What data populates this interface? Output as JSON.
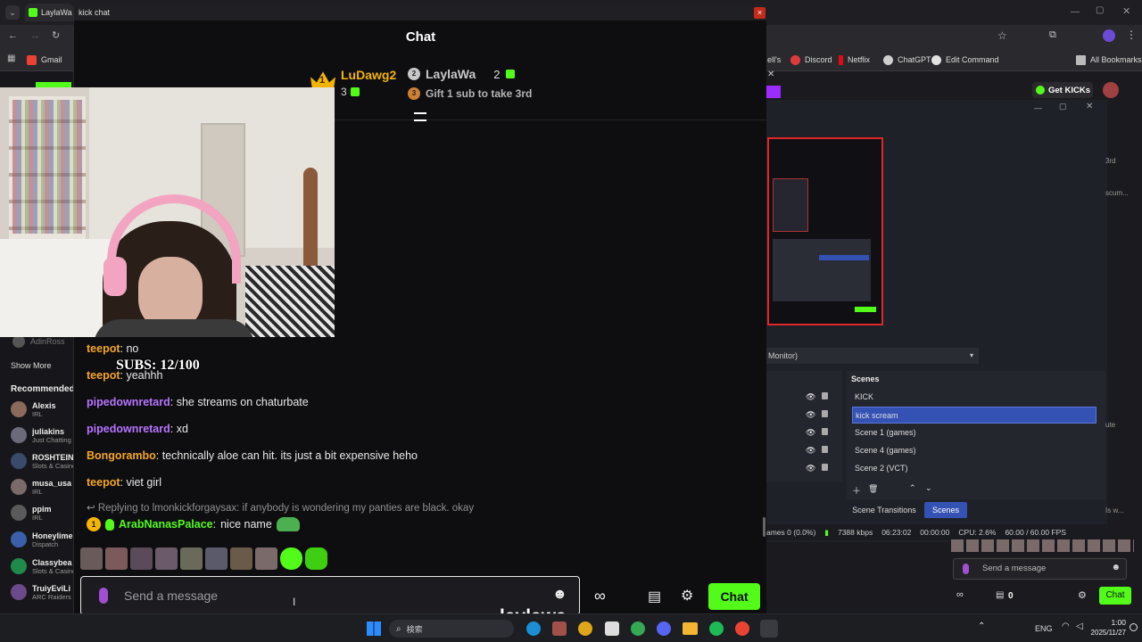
{
  "browser": {
    "tab_title": "LaylaWa",
    "bookmarks": [
      "Gmail",
      "ell's",
      "Discord",
      "Netflix",
      "ChatGPT",
      "Edit Command",
      "All Bookmarks"
    ]
  },
  "chat_window": {
    "title": "kick chat",
    "header": "Chat",
    "close_label": "×"
  },
  "leaderboard": {
    "first": {
      "rank": "1",
      "name": "LuDawg2",
      "count": "3"
    },
    "second": {
      "rank": "2",
      "name": "LaylaWa",
      "count": "2"
    },
    "third": {
      "rank": "3",
      "label": "Gift 1 sub to take 3rd"
    }
  },
  "overlay": {
    "subs": "SUBS: 12/100",
    "watermark": "laylawa"
  },
  "messages": [
    {
      "user": "teepot",
      "color": "#f5a623",
      "text": "no"
    },
    {
      "user": "teepot",
      "color": "#f5a623",
      "text": "yeahhh"
    },
    {
      "user": "pipedownretard",
      "color": "#b774ff",
      "text": "she streams on chaturbate"
    },
    {
      "user": "pipedownretard",
      "color": "#b774ff",
      "text": "xd"
    },
    {
      "user": "Bongorambo",
      "color": "#f5a623",
      "text": "technically aloe can hit. its just a bit expensive heho"
    },
    {
      "user": "teepot",
      "color": "#f5a623",
      "text": "viet girl"
    }
  ],
  "reply": {
    "text": "Replying to lmonkickforgaysax: if anybody is wondering my panties are black. okay",
    "badge": "1",
    "user": "ArabNanasPalace",
    "user_color": "#53fc18",
    "message": "nice name"
  },
  "input": {
    "placeholder": "Send a message",
    "send_label": "Chat"
  },
  "sidebar": {
    "show_more": "Show More",
    "recommended": "Recommended",
    "top_name": "AdinRoss",
    "items": [
      {
        "name": "Alexis",
        "category": "IRL"
      },
      {
        "name": "juliakins",
        "category": "Just Chatting"
      },
      {
        "name": "ROSHTEIN",
        "category": "Slots & Casino"
      },
      {
        "name": "musa_usa",
        "category": "IRL"
      },
      {
        "name": "ppim",
        "category": "IRL"
      },
      {
        "name": "Honeylime",
        "category": "Dispatch"
      },
      {
        "name": "Classybea",
        "category": "Slots & Casino"
      },
      {
        "name": "TruiyEviLi",
        "category": "ARC Raiders"
      }
    ]
  },
  "obs": {
    "monitor_label": "Monitor)",
    "scenes_title": "Scenes",
    "scenes": [
      "KICK",
      "kick scream",
      "Scene 1 (games)",
      "Scene 4 (games)",
      "Scene 2 (VCT)"
    ],
    "selected_scene": "kick scream",
    "scene_transitions": "Scene Transitions",
    "scenes_tab": "Scenes",
    "status": {
      "frames": "ames 0 (0.0%)",
      "kbps": "7388 kbps",
      "time": "06:23:02",
      "rec": "00:00:00",
      "cpu": "CPU: 2.6%",
      "fps": "60.00 / 60.00 FPS"
    }
  },
  "right_kick": {
    "get_kicks": "Get KICKs",
    "send_message": "Send a message",
    "count": "0",
    "chat_label": "Chat",
    "side_texts": [
      "3rd",
      "scum...",
      "ute",
      "Is w..."
    ]
  },
  "taskbar": {
    "search": "検索",
    "lang": "ENG",
    "time": "1:00",
    "date": "2025/11/27"
  },
  "colors": {
    "kick_green": "#53fc18",
    "scene_selected": "#3452b4",
    "obs_preview_border": "#e0262a"
  }
}
